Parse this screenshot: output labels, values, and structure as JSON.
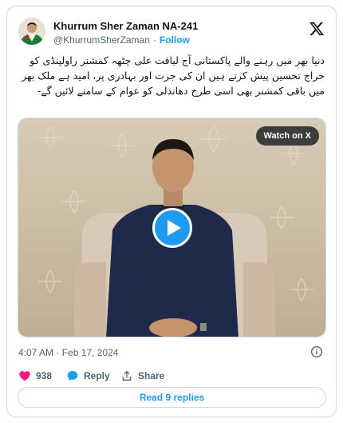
{
  "author": {
    "name": "Khurrum Sher Zaman NA-241",
    "handle": "@KhurrumSherZaman",
    "separator": "·",
    "follow_label": "Follow"
  },
  "tweet": {
    "text": "دنیا بھر میں رہنے والے پاکستانی آج لیاقت علی چٹھہ کمشنر راولپنڈی کو خراج تحسین پیش کرتے ہیں ان کی جرت اور بہادری پر، امید ہے ملک بھر میں باقی کمشنر بھی اسی طرح دھاندلی کو عوام کے سامنے لائیں گے-",
    "timestamp": "4:07 AM · Feb 17, 2024"
  },
  "media": {
    "watch_label": "Watch on X",
    "type": "video"
  },
  "actions": {
    "like_count": "938",
    "reply_label": "Reply",
    "share_label": "Share"
  },
  "footer": {
    "read_replies_label": "Read 9 replies"
  },
  "colors": {
    "accent": "#1d9bf0",
    "like": "#f91880",
    "text": "#0f1419",
    "muted": "#536471",
    "border": "#cfd9de"
  },
  "icons": [
    "x-logo-icon",
    "play-icon",
    "heart-icon",
    "reply-bubble-icon",
    "share-icon",
    "info-icon"
  ]
}
